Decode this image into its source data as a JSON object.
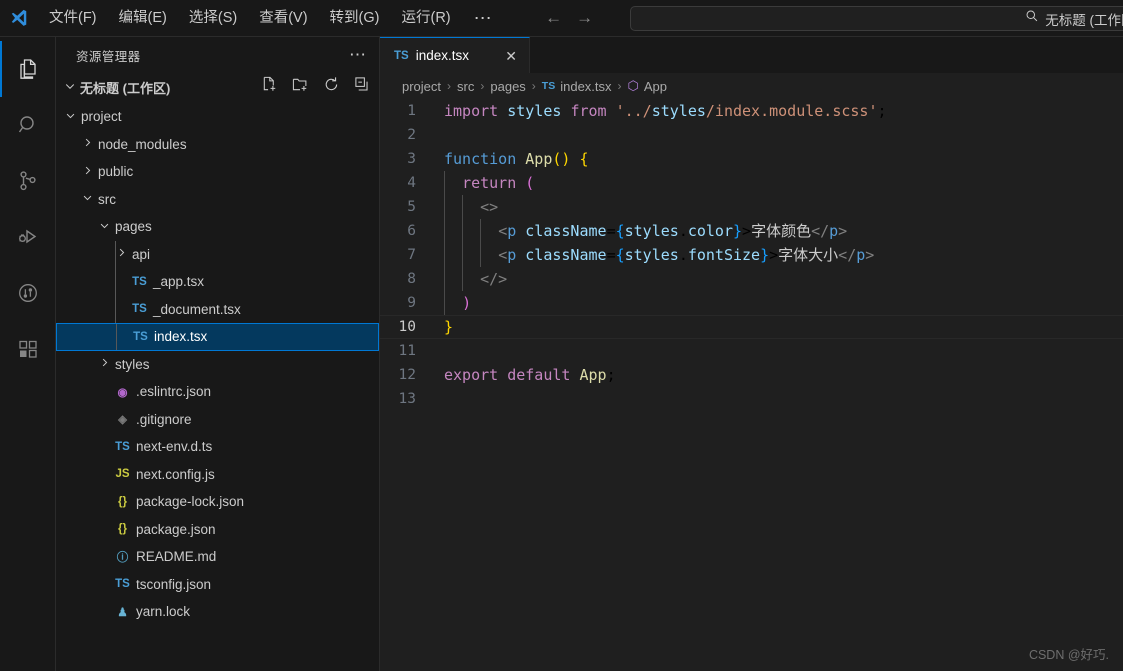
{
  "titlebar": {
    "logo_icon": "vscode-logo-icon",
    "menu": [
      {
        "label": "文件(F)",
        "name": "menu-file"
      },
      {
        "label": "编辑(E)",
        "name": "menu-edit"
      },
      {
        "label": "选择(S)",
        "name": "menu-selection"
      },
      {
        "label": "查看(V)",
        "name": "menu-view"
      },
      {
        "label": "转到(G)",
        "name": "menu-go"
      },
      {
        "label": "运行(R)",
        "name": "menu-run"
      }
    ],
    "more_label": "⋯",
    "back_label": "←",
    "forward_label": "→",
    "command_center": {
      "search_icon": "search-icon",
      "text": "无标题 (工作区)"
    }
  },
  "activitybar": {
    "items": [
      {
        "name": "activity-explorer",
        "icon": "files-icon",
        "active": true
      },
      {
        "name": "activity-search",
        "icon": "search-icon",
        "active": false
      },
      {
        "name": "activity-source-control",
        "icon": "source-control-icon",
        "active": false
      },
      {
        "name": "activity-run-debug",
        "icon": "run-and-debug-icon",
        "active": false
      },
      {
        "name": "activity-timeline",
        "icon": "git-graph-icon",
        "active": false
      },
      {
        "name": "activity-extensions",
        "icon": "extensions-icon",
        "active": false
      }
    ]
  },
  "sidebar": {
    "title": "资源管理器",
    "more_label": "⋯",
    "section": {
      "label": "无标题 (工作区)",
      "chevron": "⌄",
      "actions": [
        {
          "name": "new-file-icon",
          "title": "新建文件"
        },
        {
          "name": "new-folder-icon",
          "title": "新建文件夹"
        },
        {
          "name": "refresh-icon",
          "title": "刷新"
        },
        {
          "name": "collapse-all-icon",
          "title": "全部折叠"
        }
      ]
    },
    "tree": [
      {
        "label": "project",
        "depth": 1,
        "type": "folder",
        "expanded": true,
        "icon": "chevron-down-icon"
      },
      {
        "label": "node_modules",
        "depth": 2,
        "type": "folder",
        "expanded": false,
        "icon": "chevron-right-icon"
      },
      {
        "label": "public",
        "depth": 2,
        "type": "folder",
        "expanded": false,
        "icon": "chevron-right-icon"
      },
      {
        "label": "src",
        "depth": 2,
        "type": "folder",
        "expanded": true,
        "icon": "chevron-down-icon"
      },
      {
        "label": "pages",
        "depth": 3,
        "type": "folder",
        "expanded": true,
        "icon": "chevron-down-icon"
      },
      {
        "label": "api",
        "depth": 4,
        "type": "folder",
        "expanded": false,
        "icon": "chevron-right-icon"
      },
      {
        "label": "_app.tsx",
        "depth": 4,
        "type": "file",
        "icon": "ts-file-icon",
        "badge": "TS"
      },
      {
        "label": "_document.tsx",
        "depth": 4,
        "type": "file",
        "icon": "ts-file-icon",
        "badge": "TS"
      },
      {
        "label": "index.tsx",
        "depth": 4,
        "type": "file",
        "icon": "ts-file-icon",
        "badge": "TS",
        "selected": true
      },
      {
        "label": "styles",
        "depth": 3,
        "type": "folder",
        "expanded": false,
        "icon": "chevron-right-icon"
      },
      {
        "label": ".eslintrc.json",
        "depth": 3,
        "type": "file",
        "icon": "eslint-file-icon",
        "badge": "◉"
      },
      {
        "label": ".gitignore",
        "depth": 3,
        "type": "file",
        "icon": "git-file-icon",
        "badge": "◈"
      },
      {
        "label": "next-env.d.ts",
        "depth": 3,
        "type": "file",
        "icon": "ts-file-icon",
        "badge": "TS"
      },
      {
        "label": "next.config.js",
        "depth": 3,
        "type": "file",
        "icon": "js-file-icon",
        "badge": "JS"
      },
      {
        "label": "package-lock.json",
        "depth": 3,
        "type": "file",
        "icon": "json-file-icon",
        "badge": "{}"
      },
      {
        "label": "package.json",
        "depth": 3,
        "type": "file",
        "icon": "json-file-icon",
        "badge": "{}"
      },
      {
        "label": "README.md",
        "depth": 3,
        "type": "file",
        "icon": "markdown-file-icon",
        "badge": "ⓘ"
      },
      {
        "label": "tsconfig.json",
        "depth": 3,
        "type": "file",
        "icon": "tsconfig-file-icon",
        "badge": "TS"
      },
      {
        "label": "yarn.lock",
        "depth": 3,
        "type": "file",
        "icon": "yarn-file-icon",
        "badge": "♟"
      }
    ]
  },
  "editor": {
    "tabs": [
      {
        "label": "index.tsx",
        "icon": "ts-file-icon",
        "badge": "TS",
        "close_label": "✕",
        "active": true
      }
    ],
    "breadcrumb": [
      {
        "label": "project",
        "icon": ""
      },
      {
        "label": "src",
        "icon": ""
      },
      {
        "label": "pages",
        "icon": ""
      },
      {
        "label": "index.tsx",
        "icon": "ts-file-icon",
        "badge": "TS"
      },
      {
        "label": "App",
        "icon": "symbol-class-icon",
        "badge": "⬡"
      }
    ],
    "breadcrumb_separator": "›",
    "active_line": 10,
    "code_lines": [
      {
        "n": 1,
        "text": "import styles from '../styles/index.module.scss';"
      },
      {
        "n": 2,
        "text": ""
      },
      {
        "n": 3,
        "text": "function App() {"
      },
      {
        "n": 4,
        "text": "  return ("
      },
      {
        "n": 5,
        "text": "    <>"
      },
      {
        "n": 6,
        "text": "      <p className={styles.color}>字体颜色</p>"
      },
      {
        "n": 7,
        "text": "      <p className={styles.fontSize}>字体大小</p>"
      },
      {
        "n": 8,
        "text": "    </>"
      },
      {
        "n": 9,
        "text": "  )"
      },
      {
        "n": 10,
        "text": "}"
      },
      {
        "n": 11,
        "text": ""
      },
      {
        "n": 12,
        "text": "export default App;"
      },
      {
        "n": 13,
        "text": ""
      }
    ]
  },
  "watermark": "CSDN @好巧.",
  "colors": {
    "accent_blue": "#0078d4",
    "selection_bg": "#04395e",
    "titlebar_bg": "#181818",
    "editor_bg": "#1f1f1f",
    "sidebar_bg": "#181818",
    "text_primary": "#cccccc",
    "keyword_purple": "#c586c0",
    "keyword_blue": "#569cd6",
    "variable_blue": "#9cdcfe",
    "string_orange": "#ce9178",
    "function_yellow": "#dcdcaa"
  }
}
